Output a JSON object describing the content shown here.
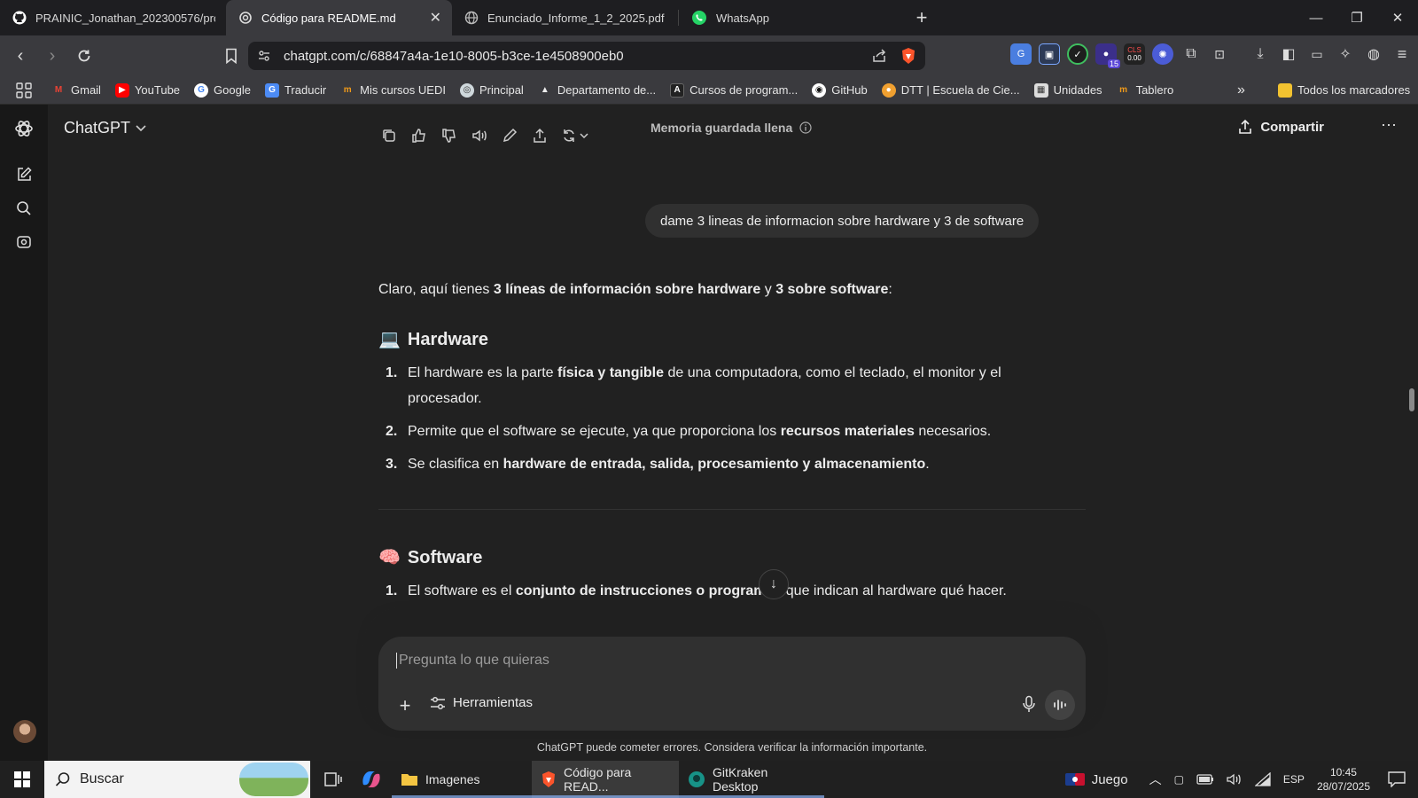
{
  "browser": {
    "tabs": [
      {
        "title": "PRAINIC_Jonathan_202300576/prom",
        "icon": "github-icon"
      },
      {
        "title": "Código para README.md",
        "icon": "chatgpt-icon",
        "active": true
      },
      {
        "title": "Enunciado_Informe_1_2_2025.pdf",
        "icon": "globe-icon"
      },
      {
        "title": "WhatsApp",
        "icon": "whatsapp-icon"
      }
    ],
    "url": "chatgpt.com/c/68847a4a-1e10-8005-b3ce-1e4508900eb0",
    "cls_badge": "0.00",
    "cls_label": "CLS",
    "ext_badge": "15",
    "bookmarks": [
      {
        "label": "Gmail",
        "color": "#ea4335"
      },
      {
        "label": "YouTube",
        "color": "#ff0000"
      },
      {
        "label": "Google",
        "color": "#4285f4"
      },
      {
        "label": "Traducir",
        "color": "#4c8bf5"
      },
      {
        "label": "Mis cursos UEDI",
        "color": "#f09a1a"
      },
      {
        "label": "Principal",
        "color": "#cfd8dc"
      },
      {
        "label": "Departamento de...",
        "color": "#111111"
      },
      {
        "label": "Cursos de program...",
        "color": "#222222"
      },
      {
        "label": "GitHub",
        "color": "#ffffff"
      },
      {
        "label": "DTT | Escuela de Cie...",
        "color": "#f0a030"
      },
      {
        "label": "Unidades",
        "color": "#dddddd"
      },
      {
        "label": "Tablero",
        "color": "#f09a1a"
      }
    ],
    "bookmarks_more": "»",
    "all_bookmarks": "Todos los marcadores"
  },
  "app": {
    "model": "ChatGPT",
    "memory_notice": "Memoria guardada llena",
    "share": "Compartir",
    "user_message": "dame 3 lineas de  informacion sobre hardware y  3 de software",
    "answer": {
      "intro_a": "Claro, aquí tienes ",
      "intro_b": "3 líneas de información sobre hardware",
      "intro_c": " y ",
      "intro_d": "3 sobre software",
      "intro_e": ":",
      "hardware_title": "Hardware",
      "hardware_icon": "💻",
      "hardware_items": [
        {
          "n": "1.",
          "a": "El hardware es la parte ",
          "b": "física y tangible",
          "c": " de una computadora, como el teclado, el monitor y el procesador."
        },
        {
          "n": "2.",
          "a": "Permite que el software se ejecute, ya que proporciona los ",
          "b": "recursos materiales",
          "c": " necesarios."
        },
        {
          "n": "3.",
          "a": "Se clasifica en ",
          "b": "hardware de entrada, salida, procesamiento y almacenamiento",
          "c": "."
        }
      ],
      "software_title": "Software",
      "software_icon": "🧠",
      "software_items": [
        {
          "n": "1.",
          "a": "El software es el ",
          "b": "conjunto de instrucciones o programas",
          "c": " que indican al hardware qué hacer."
        }
      ]
    },
    "composer_placeholder": "Pregunta lo que quieras",
    "tools_label": "Herramientas",
    "disclaimer": "ChatGPT puede cometer errores. Considera verificar la información importante."
  },
  "taskbar": {
    "search": "Buscar",
    "items": [
      {
        "label": "Imagenes"
      },
      {
        "label": "Código para READ..."
      },
      {
        "label": "GitKraken Desktop"
      }
    ],
    "game": "Juego",
    "lang": "ESP",
    "time": "10:45",
    "date": "28/07/2025"
  }
}
